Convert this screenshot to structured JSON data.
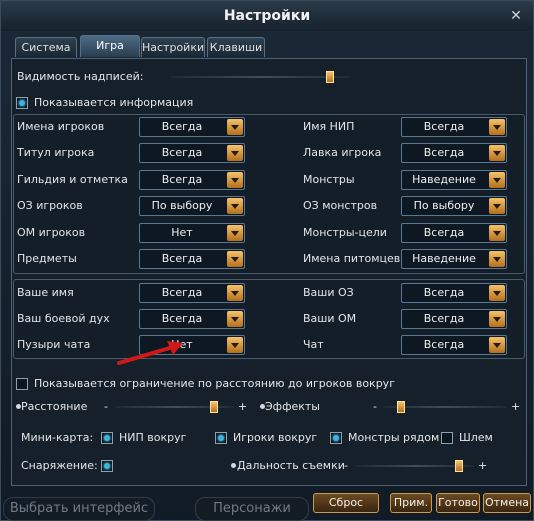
{
  "window": {
    "title": "Настройки",
    "close": "✕"
  },
  "tabs": [
    {
      "label": "Система"
    },
    {
      "label": "Игра"
    },
    {
      "label": "Настройки"
    },
    {
      "label": "Клавиши"
    }
  ],
  "visibility_label": "Видимость надписей:",
  "visibility_level": 0.9,
  "info_shown_label": "Показывается информация",
  "settings_left": [
    {
      "label": "Имена игроков",
      "value": "Всегда"
    },
    {
      "label": "Титул игрока",
      "value": "Всегда"
    },
    {
      "label": "Гильдия и отметка",
      "value": "Всегда"
    },
    {
      "label": "ОЗ игроков",
      "value": "По выбору"
    },
    {
      "label": "ОМ игроков",
      "value": "Нет"
    },
    {
      "label": "Предметы",
      "value": "Всегда"
    }
  ],
  "settings_right": [
    {
      "label": "Имя НИП",
      "value": "Всегда"
    },
    {
      "label": "Лавка игрока",
      "value": "Всегда"
    },
    {
      "label": "Монстры",
      "value": "Наведение"
    },
    {
      "label": "ОЗ монстров",
      "value": "По выбору"
    },
    {
      "label": "Монстры-цели",
      "value": "Всегда"
    },
    {
      "label": "Имена питомцев",
      "value": "Наведение"
    }
  ],
  "self_left": [
    {
      "label": "Ваше имя",
      "value": "Всегда"
    },
    {
      "label": "Ваш боевой дух",
      "value": "Всегда"
    },
    {
      "label": "Пузыри чата",
      "value": "Нет"
    }
  ],
  "self_right": [
    {
      "label": "Ваши ОЗ",
      "value": "Всегда"
    },
    {
      "label": "Ваши ОМ",
      "value": "Всегда"
    },
    {
      "label": "Чат",
      "value": "Всегда"
    }
  ],
  "distance_limit_label": "Показывается ограничение по расстоянию до игроков вокруг",
  "distance": {
    "label": "Расстояние",
    "minus": "-",
    "plus": "+",
    "level": 0.85
  },
  "effects": {
    "label": "Эффекты",
    "minus": "-",
    "plus": "+",
    "level": 0.12
  },
  "minimap": {
    "label": "Мини-карта:",
    "options": [
      {
        "label": "НИП вокруг",
        "checked": true
      },
      {
        "label": "Игроки вокруг",
        "checked": true
      },
      {
        "label": "Монстры рядом",
        "checked": true
      },
      {
        "label": "Шлем",
        "checked": false
      }
    ]
  },
  "equipment_label": "Снаряжение:",
  "draw_distance": {
    "label": "Дальность съемки",
    "minus": "-",
    "plus": "+",
    "level": 0.9
  },
  "buttons": {
    "reset": "Сброс",
    "apply": "Прим.",
    "ok": "Готово",
    "cancel": "Отмена"
  },
  "background": {
    "choose_interface": "Выбрать интерфейс",
    "characters": "Персонажи"
  },
  "colors": {
    "accent": "#34b6e0",
    "knob": "#d9953c",
    "arrow": "#d01818"
  }
}
